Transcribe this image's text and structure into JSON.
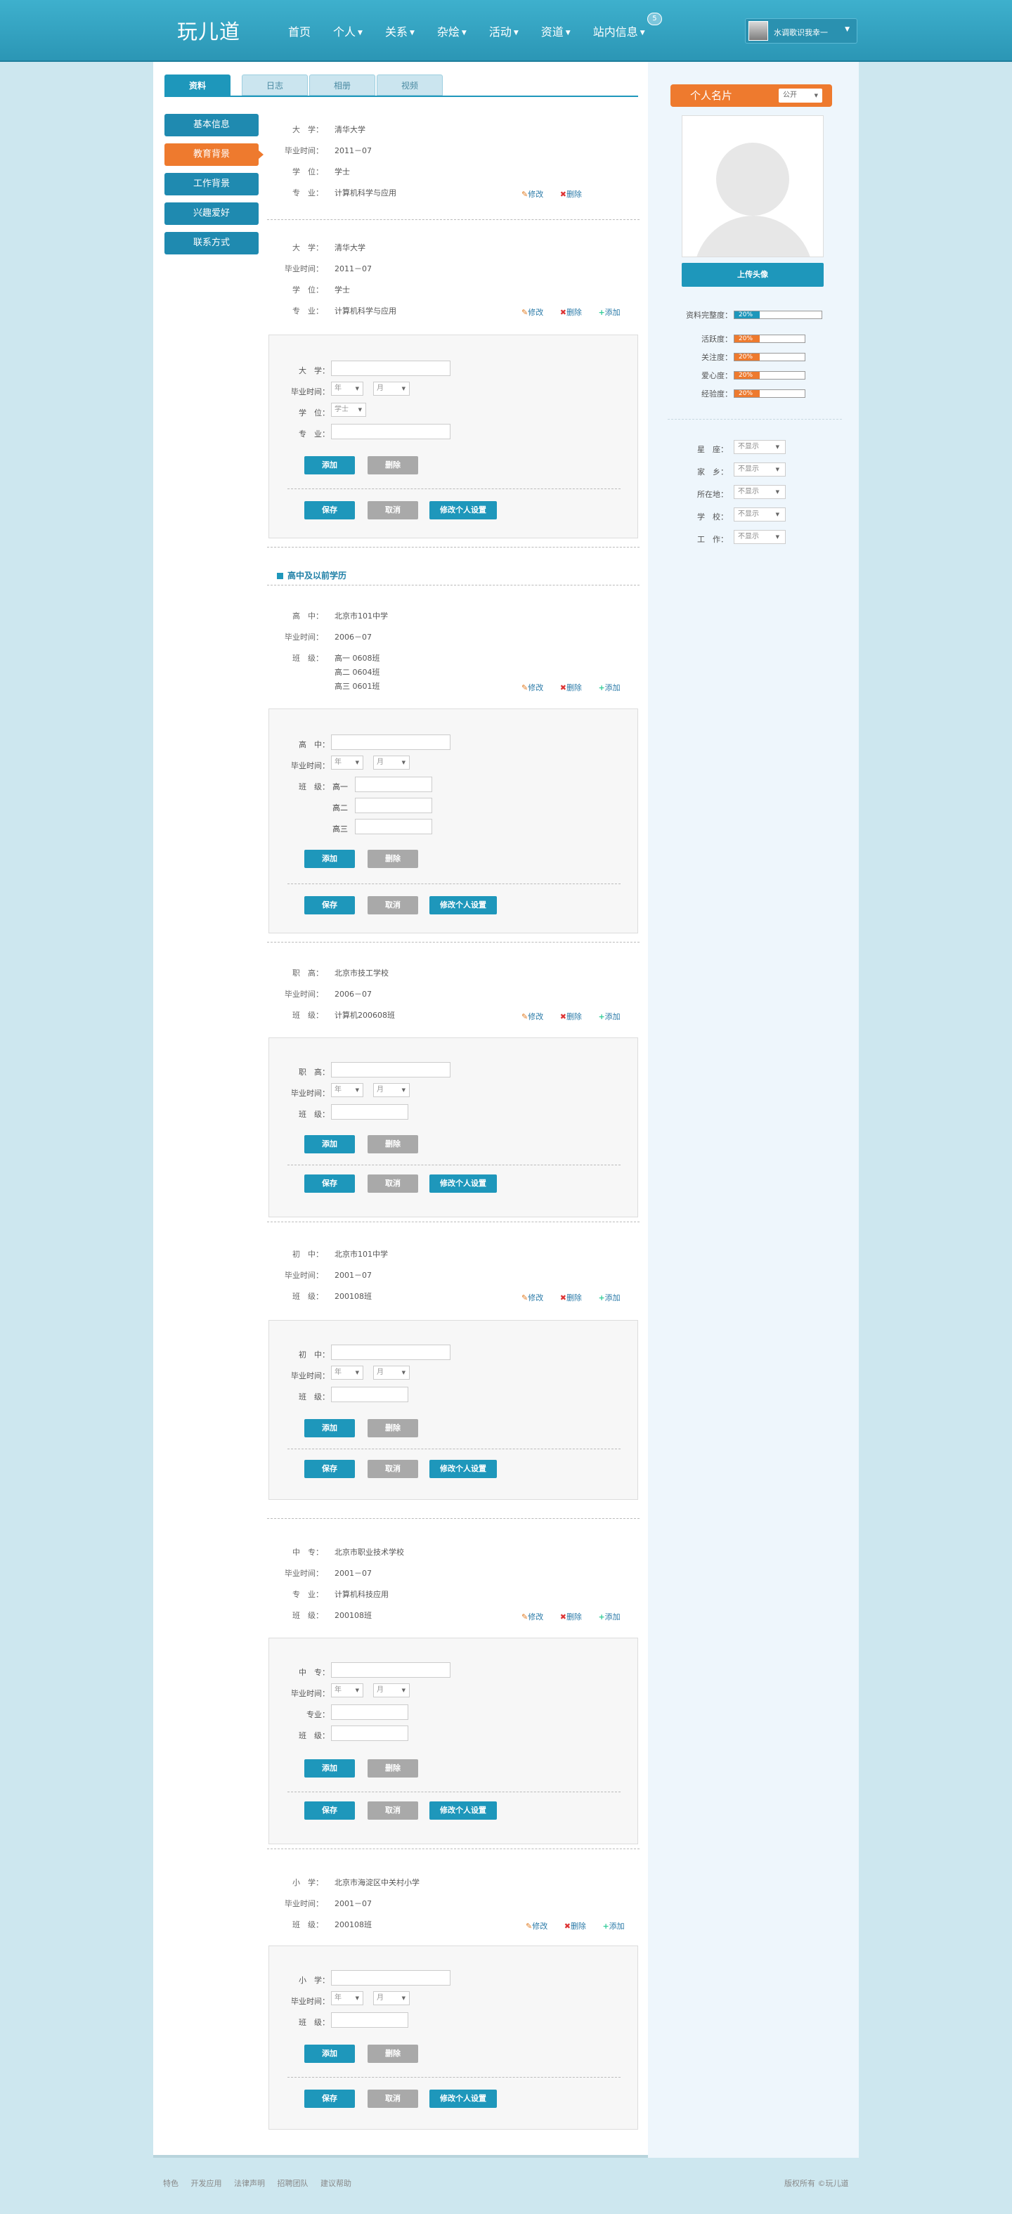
{
  "header": {
    "logo": "玩儿道",
    "nav": [
      {
        "label": "首页",
        "caret": false
      },
      {
        "label": "个人",
        "caret": true
      },
      {
        "label": "关系",
        "caret": true
      },
      {
        "label": "杂烩",
        "caret": true
      },
      {
        "label": "活动",
        "caret": true
      },
      {
        "label": "资道",
        "caret": true
      },
      {
        "label": "站内信息",
        "caret": true
      }
    ],
    "notif_count": "5",
    "username": "水调歌识我幸一"
  },
  "tabs": [
    "资料",
    "日志",
    "相册",
    "视频"
  ],
  "left_menu": [
    "基本信息",
    "教育背景",
    "工作背景",
    "兴趣爱好",
    "联系方式"
  ],
  "actions": {
    "edit": "修改",
    "delete": "删除",
    "add": "添加"
  },
  "buttons": {
    "add": "添加",
    "delete": "删除",
    "save": "保存",
    "cancel": "取消",
    "settings": "修改个人设置"
  },
  "selects": {
    "year": "年",
    "month": "月",
    "degree": "学士"
  },
  "univ1": {
    "school_label": "大　学：",
    "school": "清华大学",
    "grad_label": "毕业时间：",
    "grad": "2011－07",
    "degree_label": "学　位：",
    "degree": "学士",
    "major_label": "专　业：",
    "major": "计算机科学与应用"
  },
  "univ2": {
    "school": "清华大学",
    "grad": "2011－07",
    "degree": "学士",
    "major": "计算机科学与应用"
  },
  "univ_form": {
    "school": "大　学：",
    "grad": "毕业时间：",
    "degree": "学　位：",
    "major": "专　业："
  },
  "section_high": "高中及以前学历",
  "high": {
    "school_label": "高　中：",
    "school": "北京市101中学",
    "grad": "2006－07",
    "class_label": "班　级：",
    "g1": "高一 0608班",
    "g2": "高二 0604班",
    "g3": "高三 0601班"
  },
  "high_form": {
    "school": "高　中：",
    "grad": "毕业时间：",
    "class": "班　级：",
    "g1": "高一",
    "g2": "高二",
    "g3": "高三"
  },
  "voc": {
    "school_label": "职　高：",
    "school": "北京市技工学校",
    "grad": "2006－07",
    "class_label": "班　级：",
    "class": "计算机200608班"
  },
  "voc_form": {
    "school": "职　高：",
    "grad": "毕业时间：",
    "class": "班　级："
  },
  "mid": {
    "school_label": "初　中：",
    "school": "北京市101中学",
    "grad": "2001－07",
    "class_label": "班　级：",
    "class": "200108班"
  },
  "mid_form": {
    "school": "初　中：",
    "grad": "毕业时间：",
    "class": "班　级："
  },
  "tech": {
    "school_label": "中　专：",
    "school": "北京市职业技术学校",
    "grad": "2001－07",
    "major_label": "专　业：",
    "major": "计算机科技应用",
    "class_label": "班　级：",
    "class": "200108班"
  },
  "tech_form": {
    "school": "中　专：",
    "grad": "毕业时间：",
    "major": "专业：",
    "class": "班　级："
  },
  "prim": {
    "school_label": "小　学：",
    "school": "北京市海淀区中关村小学",
    "grad": "2001－07",
    "class_label": "班　级：",
    "class": "200108班"
  },
  "prim_form": {
    "school": "小　学：",
    "grad": "毕业时间：",
    "class": "班　级："
  },
  "card": {
    "title": "个人名片",
    "visibility": "公开",
    "upload": "上传头像",
    "stats": [
      {
        "label": "资料完整度：",
        "value": "20%",
        "fraction": 0.2,
        "color": "#1e97bb"
      },
      {
        "label": "活跃度：",
        "value": "20%",
        "fraction": 0.2,
        "color": "#ee7a2e"
      },
      {
        "label": "关注度：",
        "value": "20%",
        "fraction": 0.2,
        "color": "#ee7a2e"
      },
      {
        "label": "爱心度：",
        "value": "20%",
        "fraction": 0.2,
        "color": "#ee7a2e"
      },
      {
        "label": "经验度：",
        "value": "20%",
        "fraction": 0.2,
        "color": "#ee7a2e"
      }
    ],
    "fields": [
      {
        "label": "星　座：",
        "value": "不显示"
      },
      {
        "label": "家　乡：",
        "value": "不显示"
      },
      {
        "label": "所在地：",
        "value": "不显示"
      },
      {
        "label": "学　校：",
        "value": "不显示"
      },
      {
        "label": "工　作：",
        "value": "不显示"
      }
    ]
  },
  "footer": {
    "links": [
      "特色",
      "开发应用",
      "法律声明",
      "招聘团队",
      "建议帮助"
    ],
    "copyright": "版权所有 ©玩儿道"
  }
}
